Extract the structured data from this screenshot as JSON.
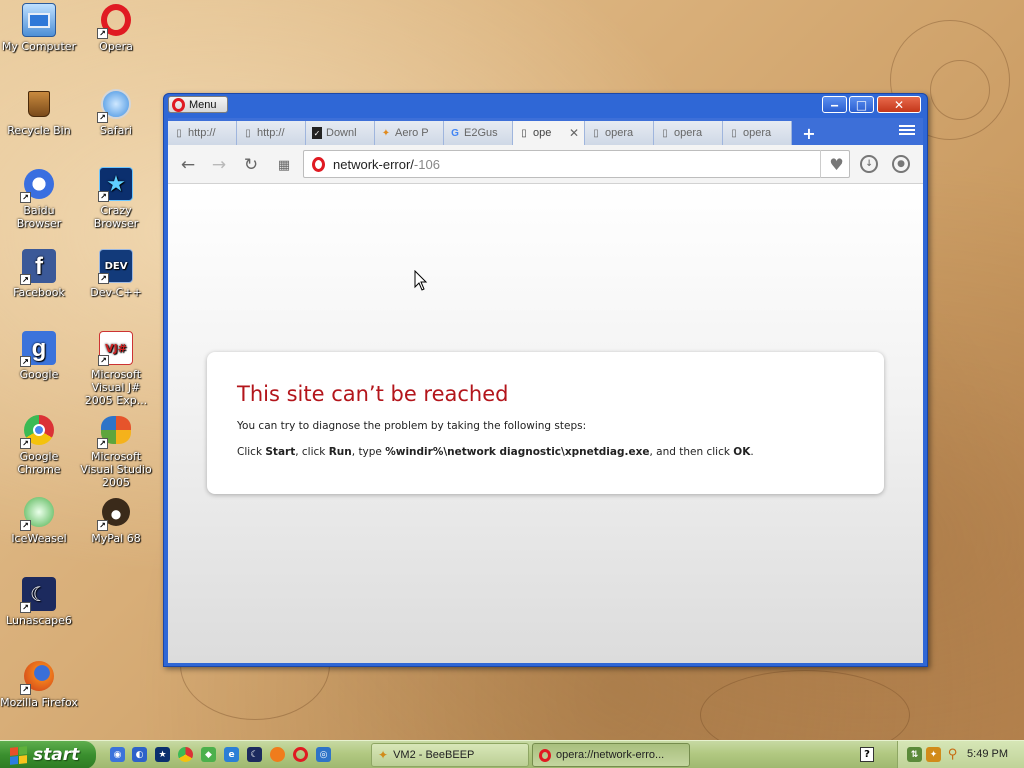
{
  "desktop": {
    "icons": [
      {
        "label": "My Computer",
        "icon": "my-computer-icon"
      },
      {
        "label": "Opera",
        "icon": "opera-icon"
      },
      {
        "label": "Recycle Bin",
        "icon": "recycle-bin-icon"
      },
      {
        "label": "Safari",
        "icon": "safari-icon"
      },
      {
        "label": "Baidu Browser",
        "icon": "baidu-browser-icon"
      },
      {
        "label": "Crazy Browser",
        "icon": "crazy-browser-icon"
      },
      {
        "label": "Facebook",
        "icon": "facebook-icon"
      },
      {
        "label": "Dev-C++",
        "icon": "dev-cpp-icon"
      },
      {
        "label": "Google",
        "icon": "google-icon"
      },
      {
        "label": "Microsoft Visual J# 2005 Exp...",
        "icon": "visual-jsharp-icon"
      },
      {
        "label": "Google Chrome",
        "icon": "chrome-icon"
      },
      {
        "label": "Microsoft Visual Studio 2005",
        "icon": "visual-studio-icon"
      },
      {
        "label": "IceWeasel",
        "icon": "iceweasel-icon"
      },
      {
        "label": "MyPal 68",
        "icon": "mypal-icon"
      },
      {
        "label": "Lunascape6",
        "icon": "lunascape-icon"
      },
      {
        "label": "Mozilla Firefox",
        "icon": "firefox-icon"
      }
    ]
  },
  "browser": {
    "menu_label": "Menu",
    "window_controls": {
      "minimize": "‒",
      "maximize": "□",
      "close": "✕"
    },
    "tabs": [
      {
        "label": "http://",
        "icon": "page-icon",
        "active": false
      },
      {
        "label": "http://",
        "icon": "page-icon",
        "active": false
      },
      {
        "label": "Downl",
        "icon": "download-site-icon",
        "active": false
      },
      {
        "label": "Aero P",
        "icon": "aero-icon",
        "active": false
      },
      {
        "label": "E2Gus",
        "icon": "google-g-icon",
        "active": false
      },
      {
        "label": "ope",
        "icon": "page-icon",
        "active": true
      },
      {
        "label": "opera",
        "icon": "page-icon",
        "active": false
      },
      {
        "label": "opera",
        "icon": "page-icon",
        "active": false
      },
      {
        "label": "opera",
        "icon": "page-icon",
        "active": false
      }
    ],
    "new_tab_label": "+",
    "address": {
      "main": "network-error/",
      "dim": "-106"
    },
    "error": {
      "title": "This site can’t be reached",
      "line1": "You can try to diagnose the problem by taking the following steps:",
      "line2_parts": [
        "Click ",
        "Start",
        ", click ",
        "Run",
        ", type ",
        "%windir%\\network diagnostic\\xpnetdiag.exe",
        ", and then click ",
        "OK",
        "."
      ]
    }
  },
  "taskbar": {
    "start_label": "start",
    "tasks": [
      {
        "label": "VM2 - BeeBEEP",
        "icon": "beebeep-icon",
        "active": false
      },
      {
        "label": "opera://network-erro...",
        "icon": "opera-icon",
        "active": true
      }
    ],
    "help_label": "?",
    "clock": "5:49 PM"
  },
  "colors": {
    "error_title": "#b3151b",
    "window_frame": "#2f67d6",
    "taskbar": "#b2c982",
    "start_button": "#3a8f2e"
  }
}
